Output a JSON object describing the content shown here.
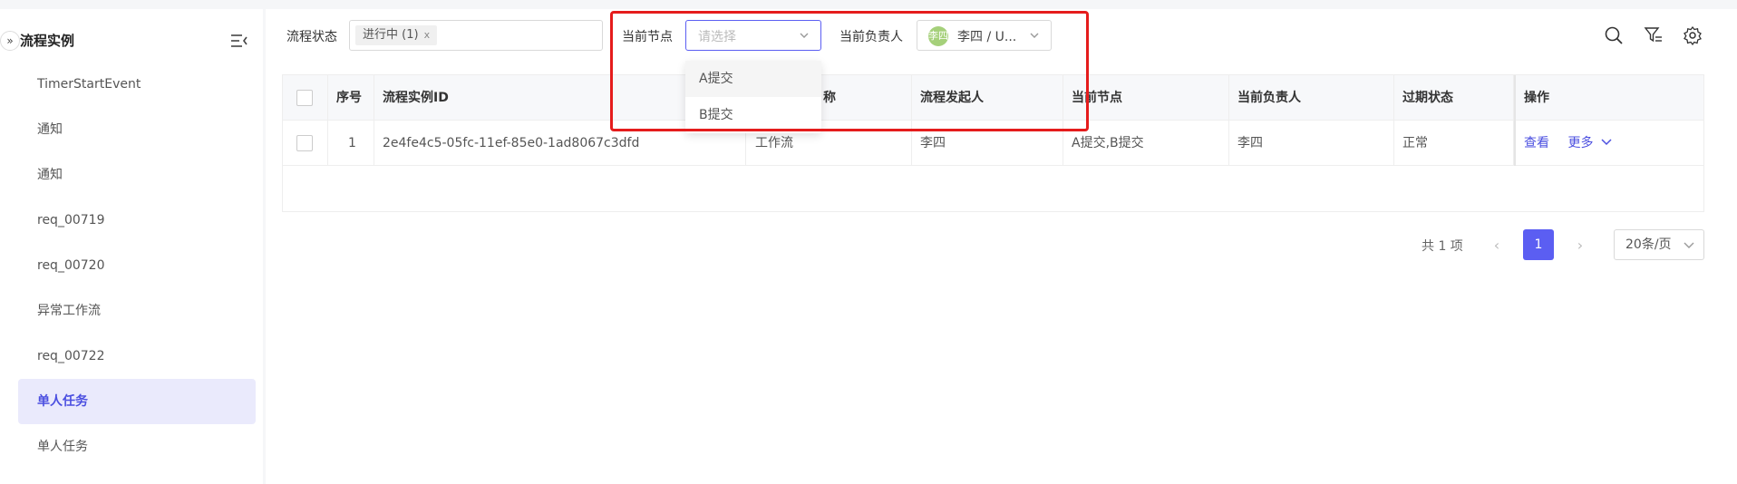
{
  "sidebar": {
    "collapse_glyph": "»",
    "title": "流程实例",
    "items": [
      {
        "label": "TimerStartEvent"
      },
      {
        "label": "通知"
      },
      {
        "label": "通知"
      },
      {
        "label": "req_00719"
      },
      {
        "label": "req_00720"
      },
      {
        "label": "异常工作流"
      },
      {
        "label": "req_00722"
      },
      {
        "label": "单人任务",
        "active": true
      },
      {
        "label": "单人任务"
      }
    ]
  },
  "filters": {
    "status_label": "流程状态",
    "status_tag": "进行中 (1)",
    "status_tag_close": "x",
    "node_label": "当前节点",
    "node_placeholder": "请选择",
    "owner_label": "当前负责人",
    "owner_avatar": "李四",
    "owner_value": "李四 / U..."
  },
  "dropdown": {
    "options": [
      "A提交",
      "B提交"
    ]
  },
  "table": {
    "headers": [
      "序号",
      "流程实例ID",
      "流程定义名称",
      "流程发起人",
      "当前节点",
      "当前负责人",
      "过期状态",
      "操作"
    ],
    "hidden_header_tail": "称",
    "rows": [
      {
        "index": "1",
        "instance_id": "2e4fe4c5-05fc-11ef-85e0-1ad8067c3dfd",
        "definition": "工作流",
        "initiator": "李四",
        "current_node": "A提交,B提交",
        "owner": "李四",
        "expiry": "正常",
        "action_view": "查看",
        "action_more": "更多"
      }
    ]
  },
  "pagination": {
    "total": "共 1 项",
    "current": "1",
    "page_size": "20条/页",
    "prev": "‹",
    "next": "›"
  },
  "colors": {
    "accent": "#5b5ef2",
    "highlight": "#e51c1c"
  }
}
